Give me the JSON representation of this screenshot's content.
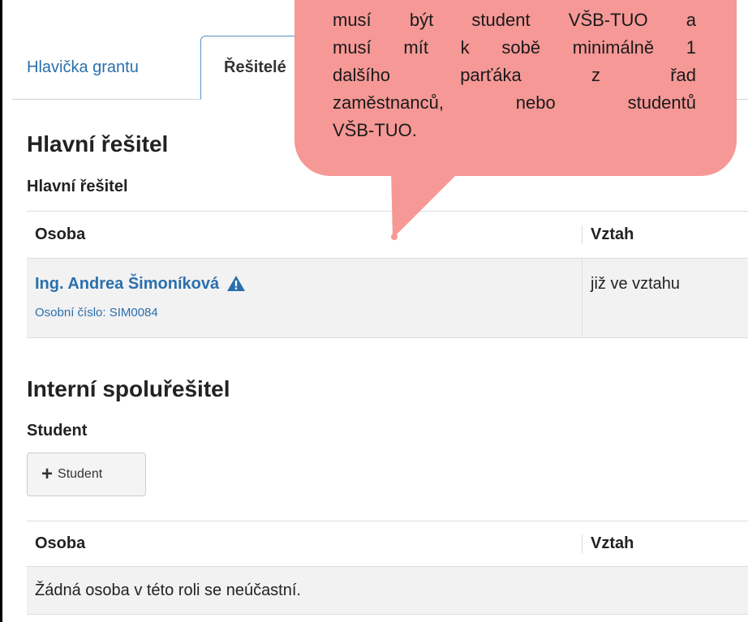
{
  "tabs": {
    "grant_header": "Hlavička grantu",
    "solvers": "Řešitelé"
  },
  "main_solver_section": {
    "title": "Hlavní řešitel",
    "subtitle": "Hlavní řešitel",
    "table": {
      "col_person": "Osoba",
      "col_relation": "Vztah",
      "rows": [
        {
          "name": "Ing. Andrea Šimoníková",
          "personal_number": "Osobní číslo: SIM0084",
          "relation": "již ve vztahu"
        }
      ]
    }
  },
  "internal_cosolver_section": {
    "title": "Interní spoluřešitel",
    "subtitle": "Student",
    "add_button_label": "Student",
    "table": {
      "col_person": "Osoba",
      "col_relation": "Vztah",
      "empty_text": "Žádná osoba v této roli se neúčastní."
    }
  },
  "callout": {
    "lines": [
      "musí být student VŠB-TUO a",
      "musí mít k sobě minimálně 1",
      "dalšího parťáka z řad",
      "zaměstnanců, nebo studentů",
      "VŠB-TUO."
    ]
  },
  "colors": {
    "link": "#2a6fad",
    "callout": "#f59896"
  }
}
